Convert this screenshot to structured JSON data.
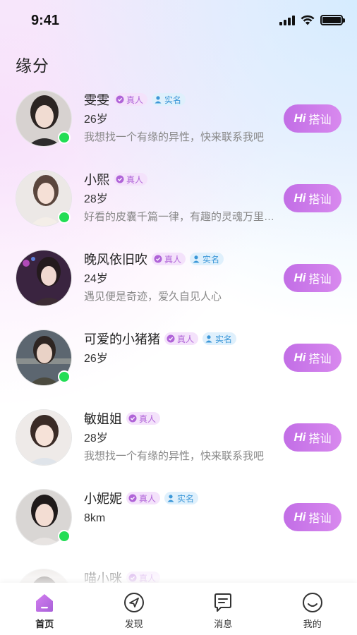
{
  "status_bar": {
    "time": "9:41"
  },
  "page": {
    "title": "缘分"
  },
  "users": [
    {
      "name": "雯雯",
      "real_badge": "真人",
      "verified_badge": "实名",
      "detail": "26岁",
      "bio": "我想找一个有缘的异性，快来联系我吧",
      "online": true,
      "verified": true
    },
    {
      "name": "小熙",
      "real_badge": "真人",
      "verified_badge": "",
      "detail": "28岁",
      "bio": "好看的皮囊千篇一律，有趣的灵魂万里挑一",
      "online": true,
      "verified": false
    },
    {
      "name": "晚风依旧吹",
      "real_badge": "真人",
      "verified_badge": "实名",
      "detail": "24岁",
      "bio": "遇见便是奇迹，爱久自见人心",
      "online": false,
      "verified": true
    },
    {
      "name": "可爱的小猪猪",
      "real_badge": "真人",
      "verified_badge": "实名",
      "detail": "26岁",
      "bio": "",
      "online": true,
      "verified": true
    },
    {
      "name": "敏姐姐",
      "real_badge": "真人",
      "verified_badge": "",
      "detail": "28岁",
      "bio": "我想找一个有缘的异性，快来联系我吧",
      "online": false,
      "verified": false
    },
    {
      "name": "小妮妮",
      "real_badge": "真人",
      "verified_badge": "实名",
      "detail": "8km",
      "bio": "",
      "online": true,
      "verified": true
    },
    {
      "name": "喵小咪",
      "real_badge": "真人",
      "verified_badge": "",
      "detail": "",
      "bio": "",
      "online": false,
      "verified": false
    }
  ],
  "action": {
    "hi": "Hi",
    "label": "搭讪"
  },
  "tabbar": {
    "items": [
      {
        "label": "首页",
        "icon": "home-icon",
        "active": true
      },
      {
        "label": "发现",
        "icon": "compass-icon",
        "active": false
      },
      {
        "label": "消息",
        "icon": "message-icon",
        "active": false
      },
      {
        "label": "我的",
        "icon": "smiley-icon",
        "active": false
      }
    ]
  },
  "colors": {
    "accent": "#c26ee6",
    "online": "#22dd55",
    "real_badge_bg": "#f4e2fb",
    "verified_badge_bg": "#dff0fc"
  }
}
